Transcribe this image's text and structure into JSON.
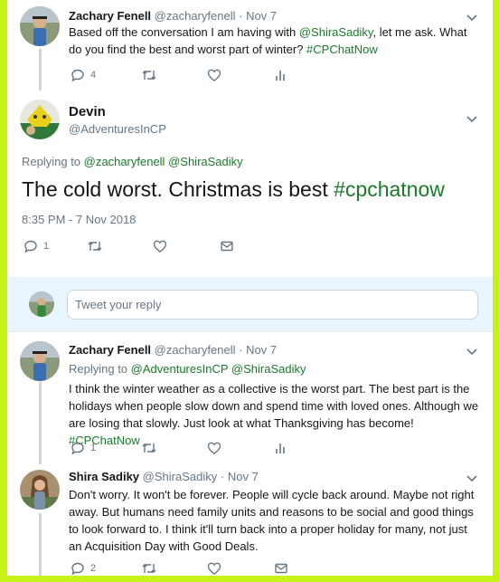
{
  "tweets": {
    "t1": {
      "name": "Zachary Fenell",
      "handle": "@zacharyfenell",
      "sep": "·",
      "date": "Nov 7",
      "text_a": "Based off the conversation I am having with ",
      "mention": "@ShiraSadiky",
      "text_b": ", let me ask. What do you find the best and worst part of winter? ",
      "hashtag": "#CPChatNow",
      "reply_count": "4"
    },
    "main": {
      "name": "Devin",
      "handle": "@AdventuresInCP",
      "replying_label": "Replying to ",
      "replying_1": "@zacharyfenell",
      "replying_2": "@ShiraSadiky",
      "text": "The cold worst. Christmas is best ",
      "hashtag": "#cpchatnow",
      "timestamp": "8:35 PM - 7 Nov 2018",
      "reply_count": "1"
    },
    "t3": {
      "name": "Zachary Fenell",
      "handle": "@zacharyfenell",
      "sep": "·",
      "date": "Nov 7",
      "replying_label": "Replying to ",
      "replying_1": "@AdventuresInCP",
      "replying_2": "@ShiraSadiky",
      "text": "I think the winter weather as a collective is the worst part. The best part is the holidays when people slow down and spend time with loved ones. Although we are losing that slowly. Just look at what Thanksgiving has become! ",
      "hashtag": "#CPChatNow",
      "reply_count": "1"
    },
    "t4": {
      "name": "Shira Sadiky",
      "handle": "@ShiraSadiky",
      "sep": "·",
      "date": "Nov 7",
      "text": "Don't worry. It won't be forever. People will cycle back around. Maybe not right away. But humans need family units and reasons to be social and good things to look forward to. I think it'll turn back into a proper holiday for many, not just an Acquisition Day with Good Deals.",
      "reply_count": "2"
    }
  },
  "reply_box": {
    "placeholder": "Tweet your reply"
  },
  "icons": [
    "reply-icon",
    "retweet-icon",
    "like-icon",
    "analytics-icon",
    "message-icon",
    "chevron-down-icon"
  ],
  "colors": {
    "accent_link": "#1b7a2c",
    "border": "#c6f21a",
    "muted": "#657786"
  }
}
